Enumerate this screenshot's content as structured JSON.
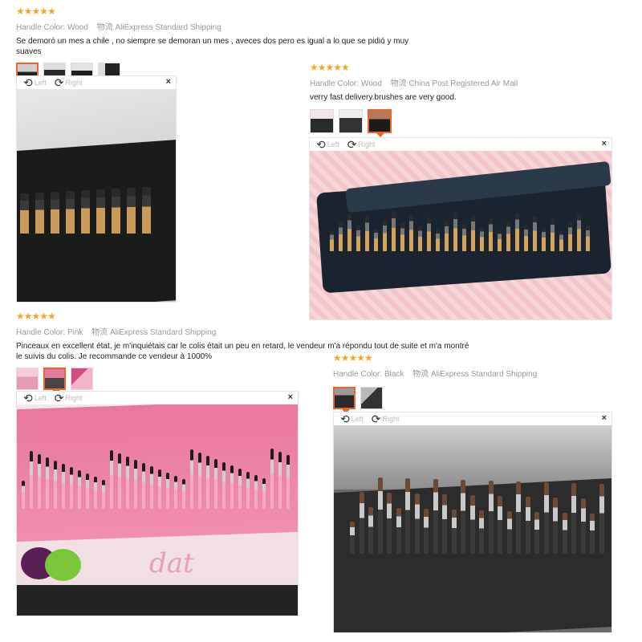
{
  "common": {
    "rotate_left": "Left",
    "rotate_right": "Right",
    "close": "×",
    "stars": "★★★★★",
    "handle_color_label": "Handle Color:"
  },
  "reviews": [
    {
      "color": "Wood",
      "ship_label": "物流",
      "shipping": "AliExpress Standard Shipping",
      "text": "Se demoró un mes a chile , no siempre se demoran un mes , aveces dos pero es igual a lo que se pidió y muy suaves"
    },
    {
      "color": "Wood",
      "ship_label": "物流",
      "shipping": "China Post Registered Air Mail",
      "text": "verry fast delivery.brushes are very good."
    },
    {
      "color": "Pink",
      "ship_label": "物流",
      "shipping": "AliExpress Standard Shipping",
      "text": "Pinceaux en excellent état, je m'inquiétais car le colis était un peu en retard, le vendeur m'a répondu tout de suite et m'a montré le suivis du colis. Je recommande ce vendeur à 1000%"
    },
    {
      "color": "Black",
      "ship_label": "物流",
      "shipping": "AliExpress Standard Shipping",
      "text": ""
    }
  ],
  "photo_text": {
    "pink_photo_script": "dat"
  },
  "colors": {
    "star": "#f5a623",
    "selected_thumb": "#e8672a"
  }
}
